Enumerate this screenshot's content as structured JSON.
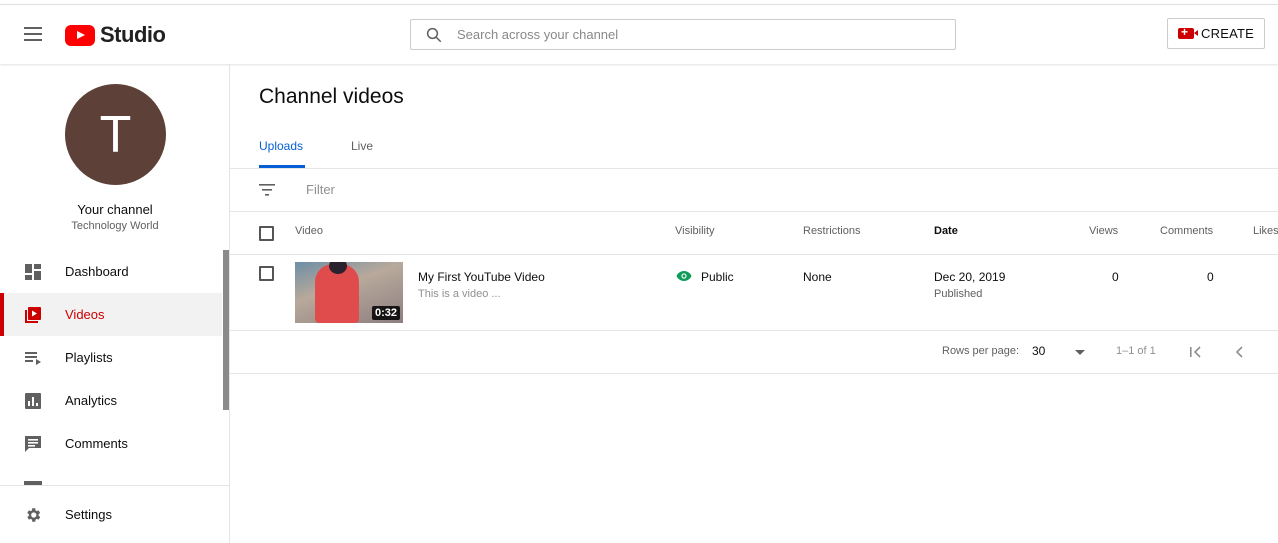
{
  "header": {
    "logo_text": "Studio",
    "search_placeholder": "Search across your channel",
    "create_label": "CREATE"
  },
  "sidebar": {
    "avatar_letter": "T",
    "avatar_color": "#5d4037",
    "channel_label": "Your channel",
    "channel_name": "Technology World",
    "items": [
      {
        "label": "Dashboard",
        "icon": "dashboard-icon"
      },
      {
        "label": "Videos",
        "icon": "videos-icon",
        "active": true
      },
      {
        "label": "Playlists",
        "icon": "playlists-icon"
      },
      {
        "label": "Analytics",
        "icon": "analytics-icon"
      },
      {
        "label": "Comments",
        "icon": "comments-icon"
      }
    ],
    "settings_label": "Settings"
  },
  "main": {
    "title": "Channel videos",
    "tabs": [
      {
        "label": "Uploads",
        "active": true
      },
      {
        "label": "Live",
        "active": false
      }
    ],
    "filter_placeholder": "Filter",
    "columns": [
      "Video",
      "Visibility",
      "Restrictions",
      "Date",
      "Views",
      "Comments",
      "Likes"
    ],
    "rows": [
      {
        "title": "My First YouTube Video",
        "description": "This is a video ...",
        "duration": "0:32",
        "visibility": "Public",
        "restrictions": "None",
        "date": "Dec 20, 2019",
        "date_status": "Published",
        "views": "0",
        "comments": "0"
      }
    ],
    "pager": {
      "rows_per_page_label": "Rows per page:",
      "rows_per_page": "30",
      "range": "1–1 of 1"
    }
  },
  "colors": {
    "accent_red": "#cc0000",
    "tab_blue": "#065fd4",
    "public_green": "#0f9d58"
  }
}
